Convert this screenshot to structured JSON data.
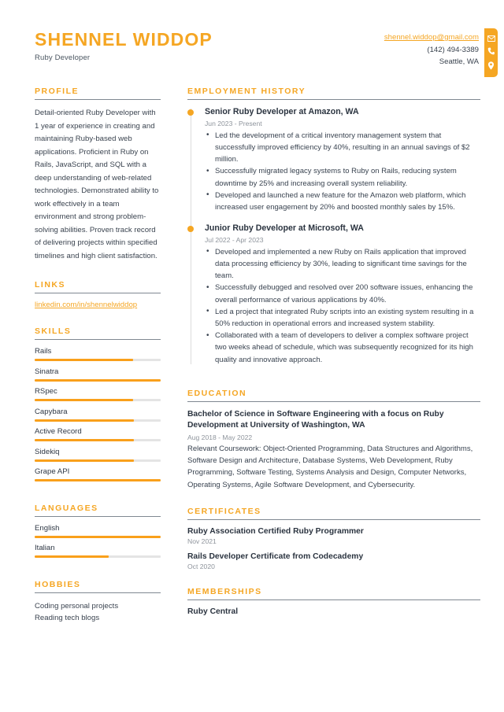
{
  "header": {
    "name": "SHENNEL WIDDOP",
    "title": "Ruby Developer",
    "email": "shennel.widdop@gmail.com",
    "phone": "(142) 494-3389",
    "location": "Seattle, WA",
    "icons": [
      "envelope-icon",
      "phone-icon",
      "location-pin-icon"
    ],
    "accent_color": "#F5A623"
  },
  "sidebar": {
    "profile": {
      "title": "PROFILE",
      "text": "Detail-oriented Ruby Developer with 1 year of experience in creating and maintaining Ruby-based web applications. Proficient in Ruby on Rails, JavaScript, and SQL with a deep understanding of web-related technologies. Demonstrated ability to work effectively in a team environment and strong problem-solving abilities. Proven track record of delivering projects within specified timelines and high client satisfaction."
    },
    "links": {
      "title": "LINKS",
      "items": [
        {
          "label": "linkedin.com/in/shennelwiddop"
        }
      ]
    },
    "skills": {
      "title": "SKILLS",
      "items": [
        {
          "name": "Rails",
          "level": 78
        },
        {
          "name": "Sinatra",
          "level": 100
        },
        {
          "name": "RSpec",
          "level": 78
        },
        {
          "name": "Capybara",
          "level": 79
        },
        {
          "name": "Active Record",
          "level": 79
        },
        {
          "name": "Sidekiq",
          "level": 79
        },
        {
          "name": "Grape API",
          "level": 100
        }
      ]
    },
    "languages": {
      "title": "LANGUAGES",
      "items": [
        {
          "name": "English",
          "level": 100
        },
        {
          "name": "Italian",
          "level": 59
        }
      ]
    },
    "hobbies": {
      "title": "HOBBIES",
      "items": [
        {
          "label": "Coding personal projects"
        },
        {
          "label": "Reading tech blogs"
        }
      ]
    }
  },
  "main": {
    "employment": {
      "title": "EMPLOYMENT HISTORY",
      "jobs": [
        {
          "heading": "Senior Ruby Developer at Amazon, WA",
          "date": "Jun 2023 - Present",
          "bullets": [
            "Led the development of a critical inventory management system that successfully improved efficiency by 40%, resulting in an annual savings of $2 million.",
            "Successfully migrated legacy systems to Ruby on Rails, reducing system downtime by 25% and increasing overall system reliability.",
            "Developed and launched a new feature for the Amazon web platform, which increased user engagement by 20% and boosted monthly sales by 15%."
          ]
        },
        {
          "heading": "Junior Ruby Developer at Microsoft, WA",
          "date": "Jul 2022 - Apr 2023",
          "bullets": [
            "Developed and implemented a new Ruby on Rails application that improved data processing efficiency by 30%, leading to significant time savings for the team.",
            "Successfully debugged and resolved over 200 software issues, enhancing the overall performance of various applications by 40%.",
            "Led a project that integrated Ruby scripts into an existing system resulting in a 50% reduction in operational errors and increased system stability.",
            "Collaborated with a team of developers to deliver a complex software project two weeks ahead of schedule, which was subsequently recognized for its high quality and innovative approach."
          ]
        }
      ]
    },
    "education": {
      "title": "EDUCATION",
      "entries": [
        {
          "heading": "Bachelor of Science in Software Engineering with a focus on Ruby Development at University of Washington, WA",
          "date": "Aug 2018 - May 2022",
          "body": "Relevant Coursework: Object-Oriented Programming, Data Structures and Algorithms, Software Design and Architecture, Database Systems, Web Development, Ruby Programming, Software Testing, Systems Analysis and Design, Computer Networks, Operating Systems, Agile Software Development, and Cybersecurity."
        }
      ]
    },
    "certificates": {
      "title": "CERTIFICATES",
      "items": [
        {
          "name": "Ruby Association Certified Ruby Programmer",
          "date": "Nov 2021"
        },
        {
          "name": "Rails Developer Certificate from Codecademy",
          "date": "Oct 2020"
        }
      ]
    },
    "memberships": {
      "title": "MEMBERSHIPS",
      "items": [
        {
          "name": "Ruby Central"
        }
      ]
    }
  }
}
